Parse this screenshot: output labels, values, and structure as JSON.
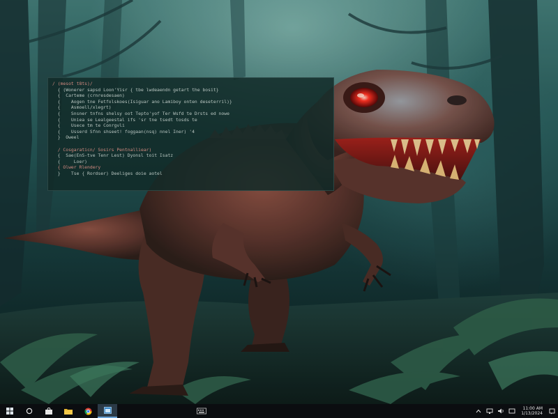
{
  "terminal": {
    "lines": [
      {
        "text": "/ (mesot t8ts)/",
        "accent": true
      },
      {
        "text": "  { (Wonerer sapsd Loon'Yisr { tbe lwdeaendn getart the bosit}",
        "accent": false
      },
      {
        "text": "  {  Carteme (crnresdesaen)",
        "accent": false
      },
      {
        "text": "  {    Aogen tne Fetfolskoes(Isiguar ano Lamiboy onten deseterril)}",
        "accent": false
      },
      {
        "text": "  {    Asmoell/xlegrt)",
        "accent": false
      },
      {
        "text": "  {    Snsner tnfns shelsy oot Tepto'yof Ter Wsfd te Drsts ed nowe",
        "accent": false
      },
      {
        "text": "  {    Uniea se Lealgeestal ifs 'sr tne tsedt tosds te",
        "accent": false
      },
      {
        "text": "  {    Usece tm te Conrgvli",
        "accent": false
      },
      {
        "text": "  {    Usserd Sfnn shseet! foggaan(nsq) nnel Iner) '4",
        "accent": false
      },
      {
        "text": "  }  Oweel",
        "accent": false
      },
      {
        "text": "",
        "accent": false
      },
      {
        "text": "  / Cosgaraticn/ Sosirs Pentnalliear)",
        "accent": true
      },
      {
        "text": "  {  Sae(EnS-tve Tenr Lest) Dyonsl toit Isatz",
        "accent": false
      },
      {
        "text": "  {     Loer)",
        "accent": false
      },
      {
        "text": "  { Olwer Rlendery",
        "accent": true
      },
      {
        "text": "  }    Tse { Rordser) Deeliges doie aotel",
        "accent": false
      }
    ]
  },
  "taskbar": {
    "clock_time": "11:00 AM",
    "clock_date": "1/13/2024"
  },
  "colors": {
    "taskbar_bg": "#0b0d10",
    "active_indicator": "#6aa3d6",
    "eye_glow": "#ff2a1a"
  }
}
